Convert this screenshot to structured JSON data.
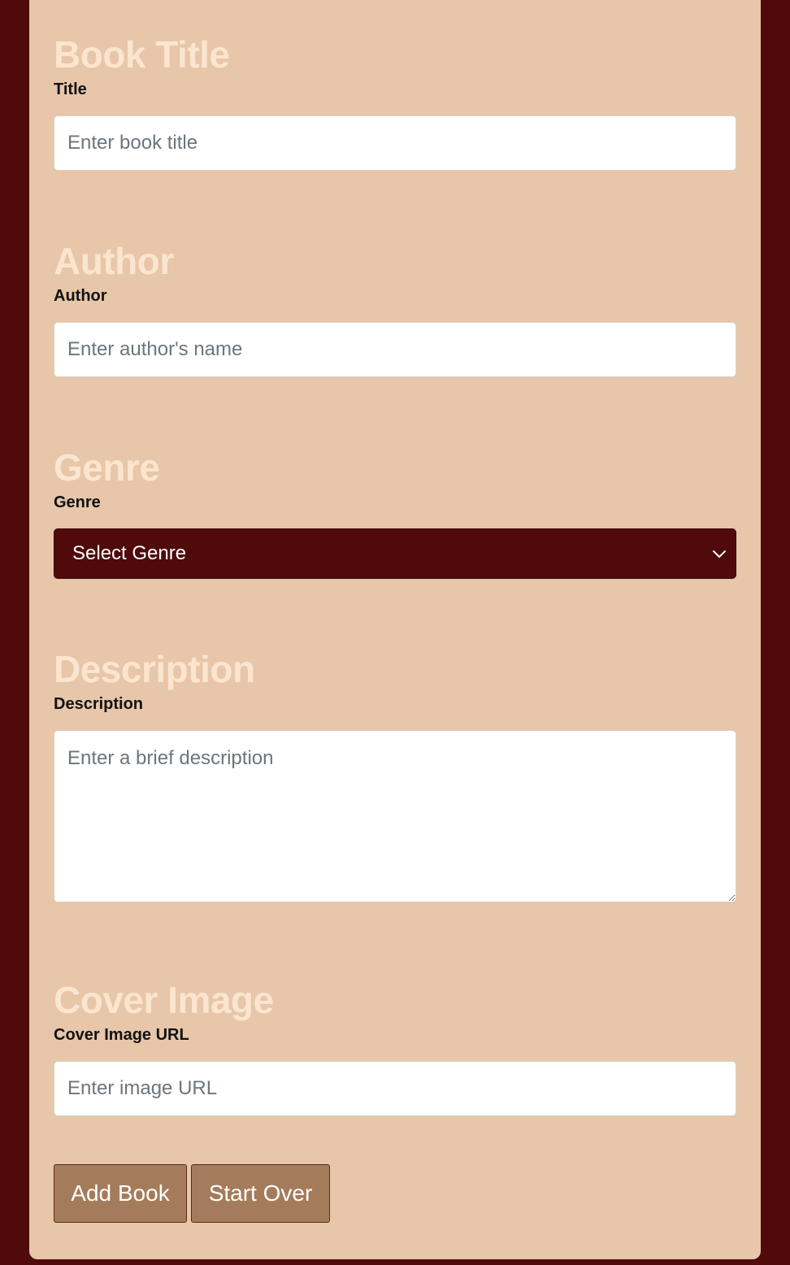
{
  "form": {
    "sections": {
      "title": {
        "heading": "Book Title",
        "label": "Title",
        "placeholder": "Enter book title"
      },
      "author": {
        "heading": "Author",
        "label": "Author",
        "placeholder": "Enter author's name"
      },
      "genre": {
        "heading": "Genre",
        "label": "Genre",
        "selected": "Select Genre"
      },
      "description": {
        "heading": "Description",
        "label": "Description",
        "placeholder": "Enter a brief description"
      },
      "cover": {
        "heading": "Cover Image",
        "label": "Cover Image URL",
        "placeholder": "Enter image URL"
      }
    },
    "buttons": {
      "add": "Add Book",
      "reset": "Start Over"
    }
  },
  "icons": {
    "genre_select": "chevron-down-icon"
  },
  "colors": {
    "page_background": "#500a0c",
    "panel_background": "#e7c6a9",
    "heading": "#fbe5cf",
    "button": "#a47c5b",
    "select_background": "#500a0c"
  }
}
